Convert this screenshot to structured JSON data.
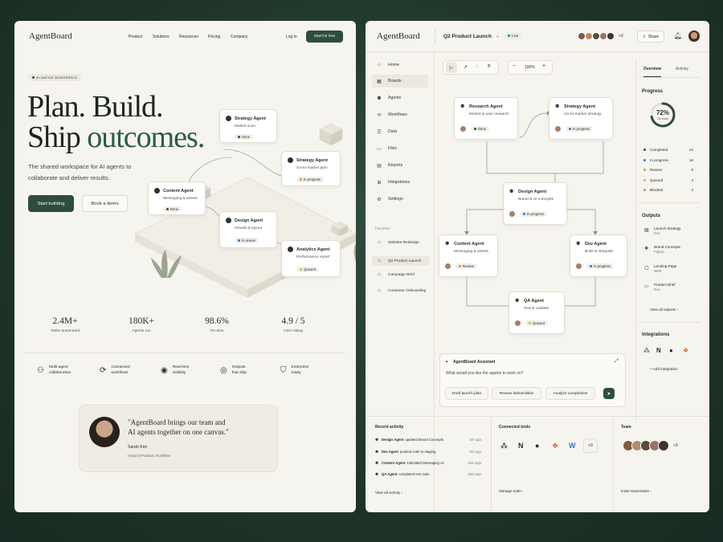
{
  "landing": {
    "logo": "AgentBoard",
    "nav": [
      "Product",
      "Solutions",
      "Resources",
      "Pricing",
      "Company"
    ],
    "login": "Log in",
    "cta": "Start for free",
    "badge": "AI-NATIVE WORKSPACE",
    "hero_line1": "Plan. Build.",
    "hero_line2a": "Ship ",
    "hero_line2b": "outcomes.",
    "subtitle_1": "The shared workspace for AI agents to",
    "subtitle_2": "collaborate and deliver results.",
    "primary_button": "Start building",
    "secondary_button": "Book a demo",
    "agents": [
      {
        "name": "Strategy Agent",
        "task": "Market scan",
        "status": "Done"
      },
      {
        "name": "Strategy Agent",
        "task": "Go-to-market plan",
        "status": "In progress"
      },
      {
        "name": "Content Agent",
        "task": "Messaging & assets",
        "status": "Done"
      },
      {
        "name": "Design Agent",
        "task": "Visuals & layout",
        "status": "In review"
      },
      {
        "name": "Analytics Agent",
        "task": "Performance report",
        "status": "Queued"
      }
    ],
    "stats": [
      {
        "value": "2.4M+",
        "label": "Tasks automated"
      },
      {
        "value": "180K+",
        "label": "Agents run"
      },
      {
        "value": "98.6%",
        "label": "On-time"
      },
      {
        "value": "4.9 / 5",
        "label": "User rating"
      }
    ],
    "features": [
      {
        "icon": "people-icon",
        "line1": "Multi-agent",
        "line2": "collaboration"
      },
      {
        "icon": "workflow-icon",
        "line1": "Connected",
        "line2": "workflows"
      },
      {
        "icon": "visibility-icon",
        "line1": "Real-time",
        "line2": "visibility"
      },
      {
        "icon": "outcome-icon",
        "line1": "Outputs",
        "line2": "that ship"
      },
      {
        "icon": "shield-icon",
        "line1": "Enterprise",
        "line2": "ready"
      }
    ],
    "quote_1": "\"AgentBoard brings our team and",
    "quote_2": "AI agents together on one canvas.\"",
    "quote_author": "Sarah Kim",
    "quote_role": "Head of Product, Northline"
  },
  "app": {
    "logo": "AgentBoard",
    "project": "Q2 Product Launch",
    "live": "Live",
    "more_avatars": "+3",
    "share": "Share",
    "nav": [
      {
        "icon": "home-icon",
        "label": "Home"
      },
      {
        "icon": "boards-icon",
        "label": "Boards"
      },
      {
        "icon": "agents-icon",
        "label": "Agents"
      },
      {
        "icon": "workflows-icon",
        "label": "Workflows"
      },
      {
        "icon": "data-icon",
        "label": "Data"
      },
      {
        "icon": "files-icon",
        "label": "Files"
      },
      {
        "icon": "reports-icon",
        "label": "Reports"
      },
      {
        "icon": "integrations-icon",
        "label": "Integrations"
      },
      {
        "icon": "settings-icon",
        "label": "Settings"
      }
    ],
    "favorites_title": "Favorites",
    "favorites": [
      "Website Redesign",
      "Q2 Product Launch",
      "Campaign Brief",
      "Customer Onboarding"
    ],
    "zoom": "100%",
    "nodes": [
      {
        "name": "Research Agent",
        "task": "Market & user research",
        "status": "Done"
      },
      {
        "name": "Strategy Agent",
        "task": "Go-to-market strategy",
        "status": "In progress"
      },
      {
        "name": "Design Agent",
        "task": "Brand & UI concepts",
        "status": "In progress"
      },
      {
        "name": "Content Agent",
        "task": "Messaging & assets",
        "status": "Review"
      },
      {
        "name": "Dev Agent",
        "task": "Build & integrate",
        "status": "In progress"
      },
      {
        "name": "QA Agent",
        "task": "Test & validate",
        "status": "Queued"
      }
    ],
    "assistant": {
      "title": "AgentBoard Assistant",
      "prompt": "What would you like the agents to work on?",
      "suggestions": [
        "Draft launch plan",
        "Review deliverables",
        "Analyze competitors"
      ]
    },
    "tabs": [
      "Overview",
      "Activity"
    ],
    "progress": {
      "title": "Progress",
      "percent": "72%",
      "caption": "On track",
      "fraction": 0.72,
      "rows": [
        {
          "label": "Completed",
          "value": "24",
          "color": "#2d4d3e"
        },
        {
          "label": "In progress",
          "value": "18",
          "color": "#3a6fd8"
        },
        {
          "label": "Review",
          "value": "6",
          "color": "#e0902f"
        },
        {
          "label": "Queued",
          "value": "4",
          "color": "#d8b44a"
        },
        {
          "label": "Blocked",
          "value": "2",
          "color": "#9a9a92"
        }
      ]
    },
    "outputs": {
      "title": "Outputs",
      "items": [
        {
          "name": "Launch Strategy",
          "type": "Doc"
        },
        {
          "name": "Brand Concepts",
          "type": "Figma"
        },
        {
          "name": "Landing Page",
          "type": "Web"
        },
        {
          "name": "Product Brief",
          "type": "Doc"
        }
      ],
      "link": "View all outputs"
    },
    "integrations": {
      "title": "Integrations",
      "add": "Add integration"
    },
    "recent": {
      "title": "Recent activity",
      "items": [
        {
          "agent": "Design Agent",
          "text": "updated Brand Concepts",
          "time": "2m ago"
        },
        {
          "agent": "Dev Agent",
          "text": "pushed code to staging",
          "time": "6m ago"
        },
        {
          "agent": "Content Agent",
          "text": "submitted Messaging v2",
          "time": "12m ago"
        },
        {
          "agent": "QA Agent",
          "text": "completed test suite",
          "time": "30m ago"
        }
      ],
      "link": "View all activity"
    },
    "tools": {
      "title": "Connected tools",
      "more": "+3",
      "link": "Manage tools"
    },
    "team": {
      "title": "Team",
      "more": "+3",
      "link": "Invite teammates"
    }
  }
}
